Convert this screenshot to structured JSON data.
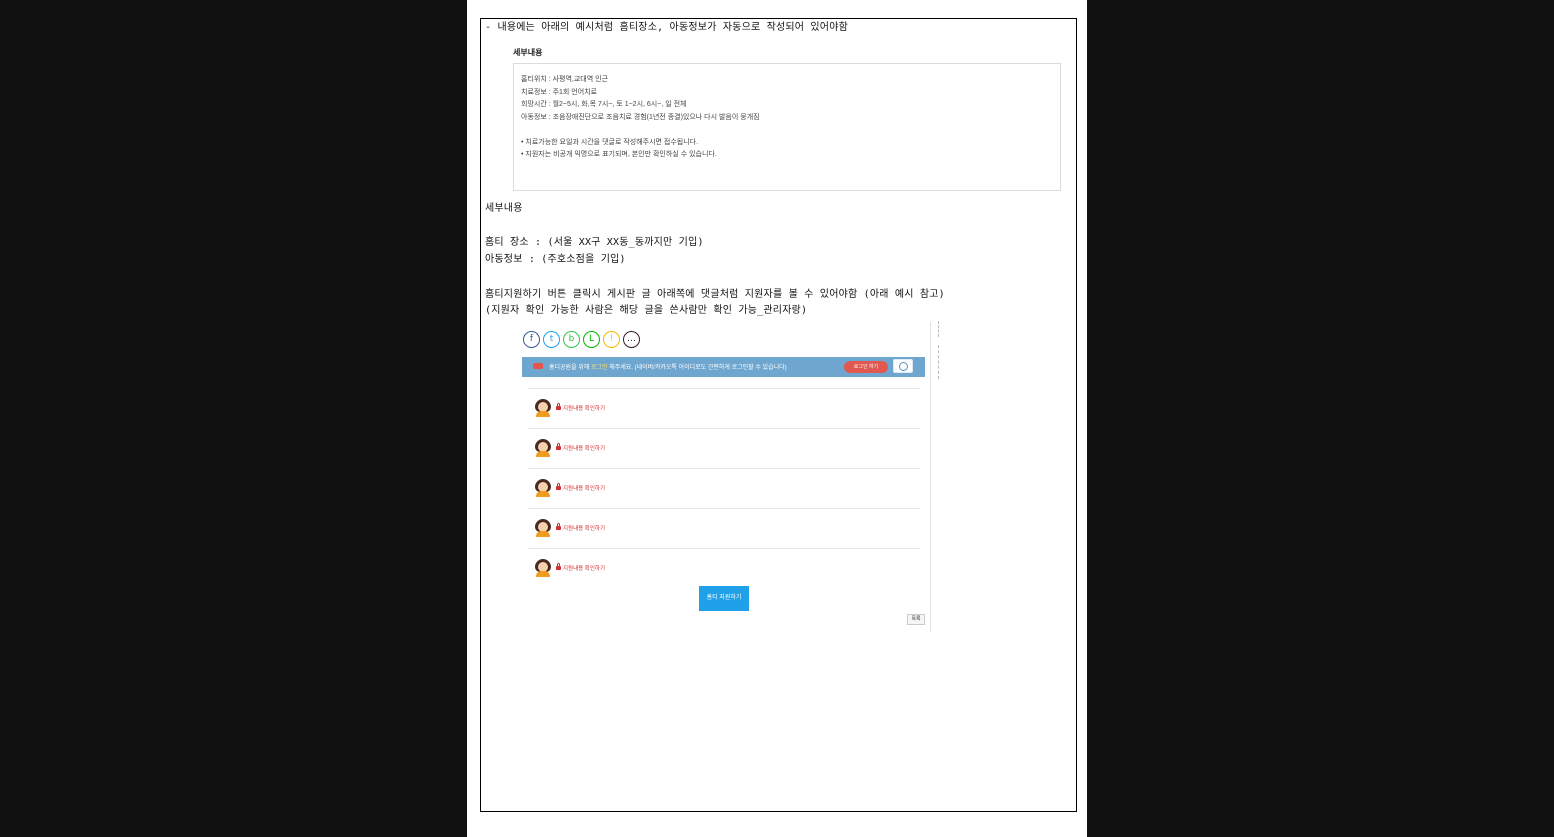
{
  "document": {
    "intro_line": "- 내용에는 아래의 예시처럼 홈티장소, 아동정보가 자동으로 작성되어 있어야함",
    "example": {
      "heading": "세부내용",
      "lines": [
        "홈티위치 : 사평역,교대역 인근",
        "치료정보 : 주1회 언어치료",
        "희망시간 : 월2~5시, 화,목 7시~, 토 1~2시, 6시~, 일 전체",
        "아동정보 : 조음장애진단으로 조음치료 경험(1년전 종결)있으나 다시 발음이 뭉개짐"
      ],
      "notes": [
        "• 치료가능한 요일과 시간을 댓글로 작성해주시면 접수됩니다.",
        "• 지원자는 비공개 익명으로 표기되며, 본인만 확인하실 수 있습니다."
      ]
    },
    "template_heading": "세부내용",
    "template_place": "홈티 장소 : (서울 XX구 XX동_동까지만 기입)",
    "template_child": "아동정보 : (주호소점을 기입)",
    "requirement_line1": "홈티지원하기 버튼 클릭시 게시판 글 아래쪽에 댓글처럼 지원자를 볼 수 있어야함 (아래 예시 참고)",
    "requirement_line2": "(지원자 확인 가능한 사람은 해당 글을 쓴사람만 확인 가능_관리자랑)"
  },
  "embedded_screenshot": {
    "share_icons": [
      "facebook-icon",
      "twitter-icon",
      "band-icon",
      "line-icon",
      "kakaostory-icon",
      "kakaotalk-icon"
    ],
    "share_glyphs": [
      "f",
      "t",
      "b",
      "L",
      "!",
      "…"
    ],
    "share_colors": [
      "#3b5998",
      "#1da1f2",
      "#2dc64b",
      "#00b900",
      "#f5b800",
      "#3a1d1d"
    ],
    "banner": {
      "tag": "TIP",
      "text_before": "홈디공원을 위해 ",
      "highlight": "로그인",
      "text_after": " 해주세요. (네이버/카카오톡 아이디로도 간편하게 로그인할 수 있습니다)",
      "login_button": "로그인 하기"
    },
    "comments": [
      {
        "label": "지원내용 확인하기"
      },
      {
        "label": "지원내용 확인하기"
      },
      {
        "label": "지원내용 확인하기"
      },
      {
        "label": "지원내용 확인하기"
      },
      {
        "label": "지원내용 확인하기"
      }
    ],
    "apply_button": "홈티 지원하기",
    "list_button": "목록"
  },
  "colors": {
    "banner": "#6fa6cf",
    "apply_button": "#1fa0e8",
    "lock_red": "#d43030",
    "login_button": "#e0584f"
  }
}
